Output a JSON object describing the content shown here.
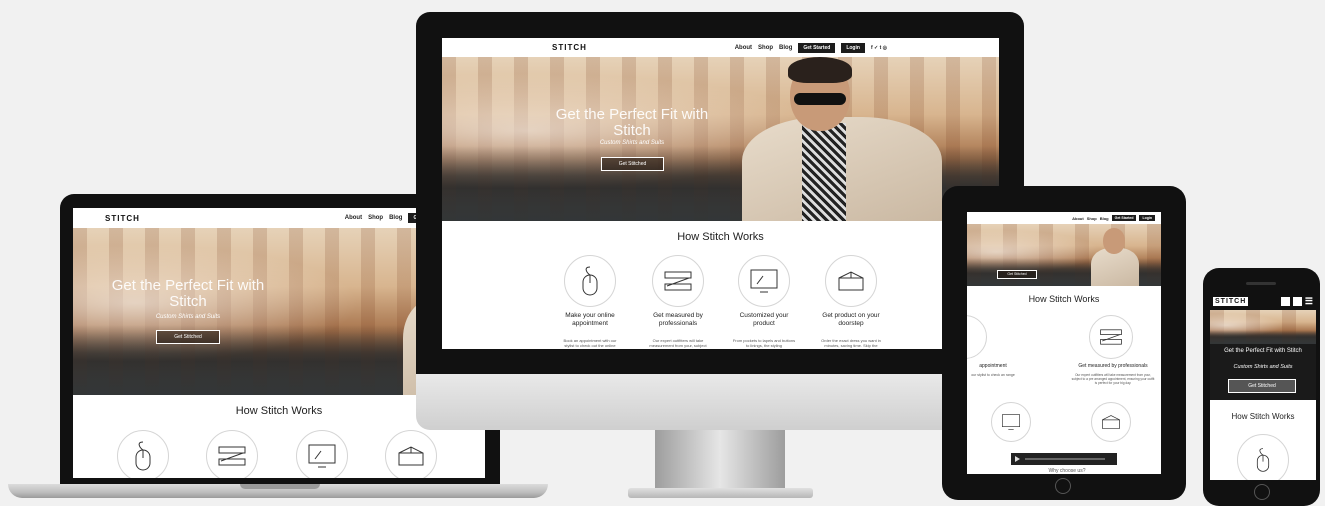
{
  "brand": {
    "logo": "STITCH"
  },
  "nav": {
    "about": "About",
    "shop": "Shop",
    "blog": "Blog",
    "get_started": "Get Started",
    "login": "Login",
    "social": "f  ✓  t  ◎"
  },
  "hero": {
    "title": "Get the Perfect Fit with Stitch",
    "subtitle": "Custom Shirts and Suits",
    "cta": "Get Stitched"
  },
  "how": {
    "title": "How Stitch Works",
    "steps": [
      {
        "icon": "mouse-icon",
        "title": "Make your online appointment",
        "desc": "Book an appointment with our stylist to check out the online"
      },
      {
        "icon": "measuring-tape-icon",
        "title": "Get measured by professionals",
        "desc": "Our expert outfitters will take measurement from your, subject"
      },
      {
        "icon": "monitor-icon",
        "title": "Customized your product",
        "desc": "From pockets to lapels and buttons to linings, the styling"
      },
      {
        "icon": "box-icon",
        "title": "Get product on your doorstep",
        "desc": "Order the exact dress you want in minutes, saving time. Skip the"
      }
    ]
  },
  "tablet": {
    "step_left_title": "appointment",
    "step_left_desc": "our stylist to check an range",
    "step_right_title": "Get measured by professionals",
    "step_right_desc": "Our expert outfitters will take measurement from your, subject to a pre arranged appointment, ensuring your outfit is perfect for your big day.",
    "video_label": "Why choose us?"
  },
  "phone": {
    "hero_title": "Get the Perfect Fit with Stitch",
    "hero_subtitle": "Custom Shirts and Suits",
    "cta": "Get Stitched",
    "how_title": "How Stitch Works"
  },
  "colors": {
    "background": "#f1f1f1",
    "nav_button": "#1c1c1c",
    "bezel": "#111111"
  }
}
